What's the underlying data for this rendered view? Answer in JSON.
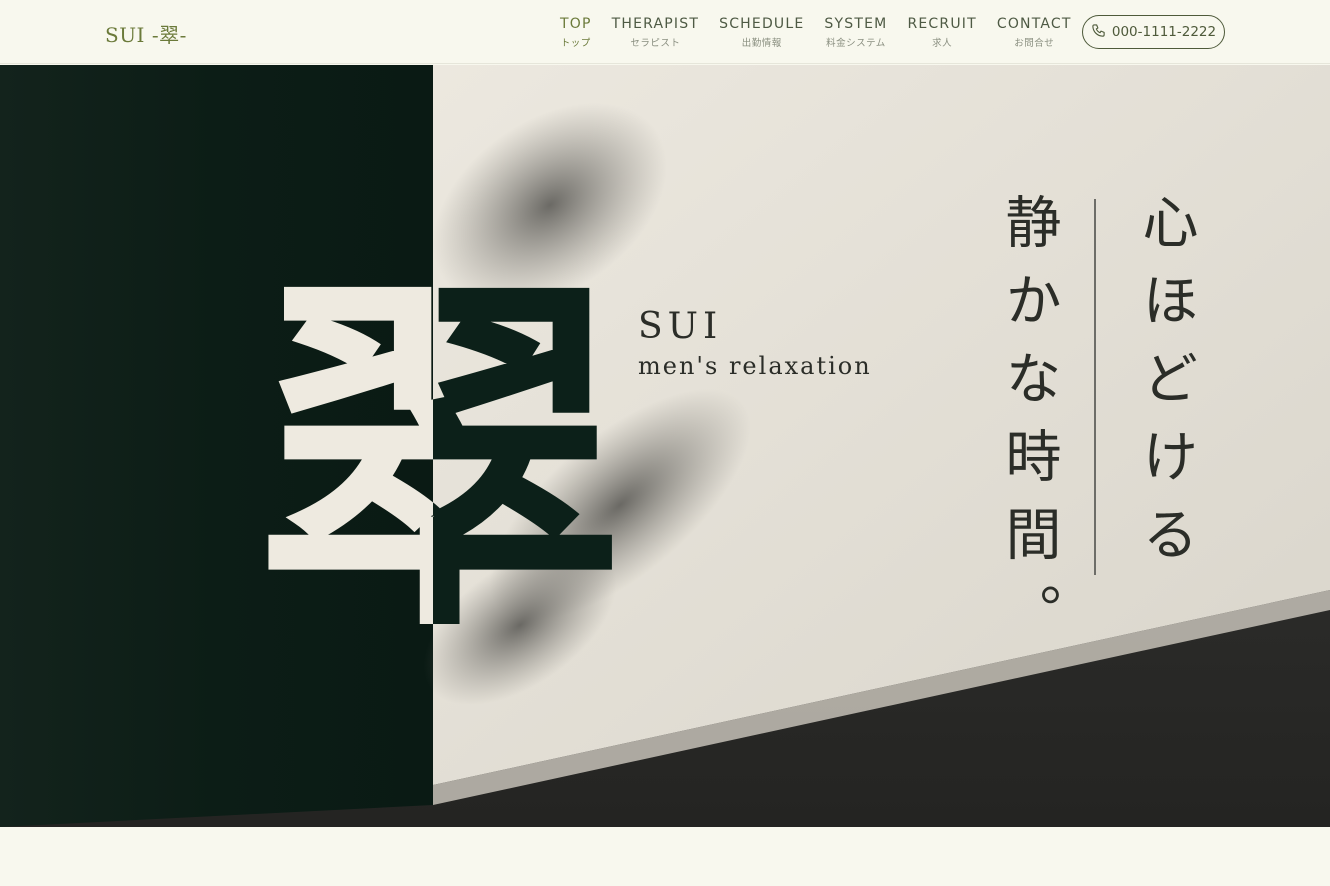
{
  "header": {
    "logo": "SUI -翠-",
    "nav": [
      {
        "en": "TOP",
        "ja": "トップ",
        "active": true
      },
      {
        "en": "THERAPIST",
        "ja": "セラピスト",
        "active": false
      },
      {
        "en": "SCHEDULE",
        "ja": "出勤情報",
        "active": false
      },
      {
        "en": "SYSTEM",
        "ja": "料金システム",
        "active": false
      },
      {
        "en": "RECRUIT",
        "ja": "求人",
        "active": false
      },
      {
        "en": "CONTACT",
        "ja": "お問合せ",
        "active": false
      }
    ],
    "phone": "000-1111-2222",
    "phone_icon": "phone-icon"
  },
  "hero": {
    "kanji": "翠",
    "brand_name": "SUI",
    "brand_sub": "men's relaxation",
    "tagline_line1": "心ほどける",
    "tagline_line2": "静かな時間。"
  },
  "colors": {
    "background": "#f8f8ee",
    "accent": "#6b7a3a",
    "panel_dark": "#0c2019",
    "paper": "#eeeae0"
  }
}
